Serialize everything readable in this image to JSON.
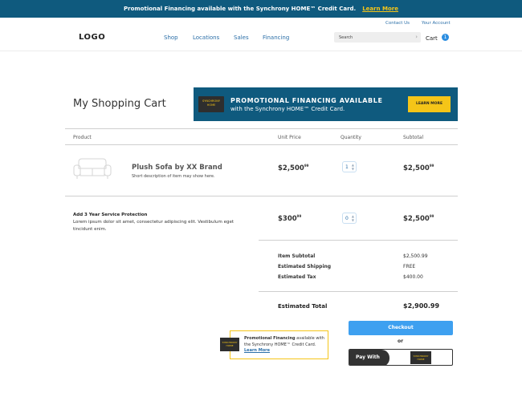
{
  "promo_bar": {
    "text": "Promotional Financing available with the Synchrony HOME™ Credit Card.",
    "link": "Learn More"
  },
  "utility": {
    "contact": "Contact Us",
    "account": "Your Account"
  },
  "header": {
    "logo": "LOGO",
    "nav": [
      "Shop",
      "Locations",
      "Sales",
      "Financing"
    ],
    "search_placeholder": "Search",
    "cart_label": "Cart",
    "cart_count": "1"
  },
  "page_title": "My Shopping Cart",
  "banner": {
    "card_text": "SYNCHRONY HOME",
    "heading": "PROMOTIONAL FINANCING AVAILABLE",
    "subtext": "with the Synchrony HOME™ Credit Card.",
    "button": "LEARN MORE"
  },
  "table_headers": [
    "Product",
    "Unit Price",
    "Quantity",
    "Subtotal"
  ],
  "item": {
    "name": "Plush Sofa by XX Brand",
    "description": "Short description of item may show here.",
    "unit_price": "$2,500",
    "unit_cents": "99",
    "quantity": "1",
    "subtotal": "$2,500",
    "subtotal_cents": "99"
  },
  "service": {
    "title": "Add 3 Year Service Protection",
    "description": "Lorem ipsum dolor sit amet, consectetur adipiscing elit. Vestibulum eget tincidunt enim.",
    "unit_price": "$300",
    "unit_cents": "99",
    "quantity": "0",
    "subtotal": "$2,500",
    "subtotal_cents": "99"
  },
  "summary": {
    "rows": [
      {
        "label": "Item Subtotal",
        "value": "$2,500.99"
      },
      {
        "label": "Estimated Shipping",
        "value": "FREE"
      },
      {
        "label": "Estimated Tax",
        "value": "$400.00"
      }
    ],
    "total_label": "Estimated Total",
    "total_value": "$2,900.99"
  },
  "promo_box": {
    "card_text": "SYNCHRONY HOME",
    "bold": "Promotional Financing",
    "text": " available with the Synchrony HOME™ Credit Card. ",
    "link": "Learn More"
  },
  "actions": {
    "checkout": "Checkout",
    "or": "or",
    "pay_with": "Pay With",
    "pay_card": "SYNCHRONY HOME"
  },
  "colors": {
    "brand_blue": "#0f5a7e",
    "accent_yellow": "#f5c518",
    "button_blue": "#3ea0f0",
    "link_blue": "#2b6fa8"
  }
}
